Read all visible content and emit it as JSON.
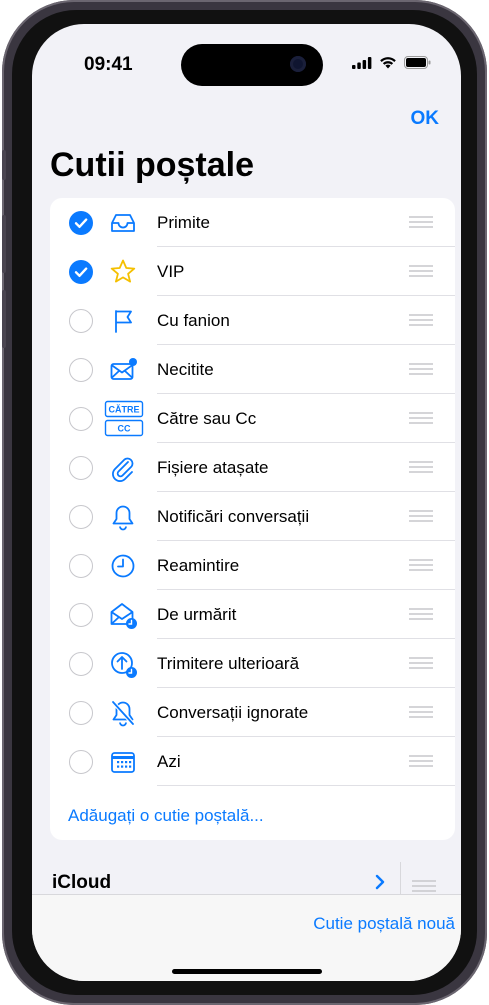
{
  "status": {
    "time": "09:41"
  },
  "header": {
    "done_label": "OK",
    "title": "Cutii poștale"
  },
  "mailboxes": [
    {
      "label": "Primite",
      "checked": true,
      "icon": "tray-icon"
    },
    {
      "label": "VIP",
      "checked": true,
      "icon": "star-icon"
    },
    {
      "label": "Cu fanion",
      "checked": false,
      "icon": "flag-icon"
    },
    {
      "label": "Necitite",
      "checked": false,
      "icon": "unread-envelope-icon"
    },
    {
      "label": "Către sau Cc",
      "checked": false,
      "icon": "to-cc-icon",
      "icon_text": [
        "CĂTRE",
        "CC"
      ]
    },
    {
      "label": "Fișiere atașate",
      "checked": false,
      "icon": "paperclip-icon"
    },
    {
      "label": "Notificări conversații",
      "checked": false,
      "icon": "bell-icon"
    },
    {
      "label": "Reamintire",
      "checked": false,
      "icon": "clock-icon"
    },
    {
      "label": "De urmărit",
      "checked": false,
      "icon": "follow-up-icon"
    },
    {
      "label": "Trimitere ulterioară",
      "checked": false,
      "icon": "send-later-icon"
    },
    {
      "label": "Conversații ignorate",
      "checked": false,
      "icon": "muted-bell-icon"
    },
    {
      "label": "Azi",
      "checked": false,
      "icon": "calendar-icon"
    }
  ],
  "add_mailbox_label": "Adăugați o cutie poștală...",
  "account": {
    "name": "iCloud"
  },
  "toolbar": {
    "new_mailbox_label": "Cutie poștală nouă"
  },
  "colors": {
    "accent": "#0a7aff",
    "background": "#f2f2f7"
  }
}
